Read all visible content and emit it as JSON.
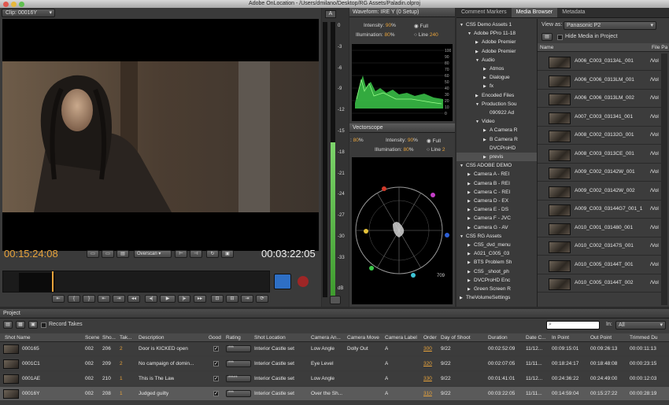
{
  "window": {
    "title": "Adobe OnLocation - /Users/dmilano/Desktop/RG Assets/Paladin.olproj"
  },
  "monitor": {
    "clip_label": "Clip: 00016Y",
    "timecode_current": "00:15:24:08",
    "timecode_duration": "00:03:22:05",
    "overscan": "Overscan"
  },
  "meter": {
    "label": "A",
    "ticks": [
      "0",
      "-3",
      "-6",
      "-9",
      "-12",
      "-15",
      "-18",
      "-21",
      "-24",
      "-27",
      "-30",
      "-33"
    ],
    "db": "dB"
  },
  "waveform": {
    "title": "Waveform: IRE Y (0 Setup)",
    "intensity_label": "Intensity:",
    "intensity_value": "90",
    "illumination_label": "Illumination:",
    "illumination_value": "80",
    "pct": "%",
    "opt_full": "Full",
    "opt_line": "Line",
    "line_value": "240",
    "scale": [
      "100",
      "90",
      "80",
      "70",
      "60",
      "50",
      "40",
      "30",
      "20",
      "10",
      "0"
    ]
  },
  "vectorscope": {
    "title": "Vectorscope",
    "left_value": "80",
    "pct": "%",
    "intensity_label": "Intensity:",
    "intensity_value": "90",
    "illumination_label": "Illumination:",
    "illumination_value": "80",
    "opt_full": "Full",
    "opt_line": "Line",
    "line_value": "2",
    "readout": "709"
  },
  "tabs": {
    "comment_markers": "Comment Markers",
    "media_browser": "Media Browser",
    "metadata": "Metadata"
  },
  "tree": [
    {
      "indent": 0,
      "arrow": "▼",
      "label": "CS5 Demo Assets 1"
    },
    {
      "indent": 1,
      "arrow": "▼",
      "label": "Adobe PPro 11-18"
    },
    {
      "indent": 2,
      "arrow": "▶",
      "label": "Adobe Premier"
    },
    {
      "indent": 2,
      "arrow": "▶",
      "label": "Adobe Premier"
    },
    {
      "indent": 2,
      "arrow": "▼",
      "label": "Audio"
    },
    {
      "indent": 3,
      "arrow": "▶",
      "label": "Atmos"
    },
    {
      "indent": 3,
      "arrow": "▶",
      "label": "Dialogue"
    },
    {
      "indent": 3,
      "arrow": "▶",
      "label": "fx"
    },
    {
      "indent": 2,
      "arrow": "▶",
      "label": "Encoded Files"
    },
    {
      "indent": 2,
      "arrow": "▼",
      "label": "Production Sou"
    },
    {
      "indent": 3,
      "arrow": "",
      "label": "090922 Ad"
    },
    {
      "indent": 2,
      "arrow": "▼",
      "label": "Video"
    },
    {
      "indent": 3,
      "arrow": "▶",
      "label": "A Camera R"
    },
    {
      "indent": 3,
      "arrow": "▶",
      "label": "B Camera R"
    },
    {
      "indent": 3,
      "arrow": "",
      "label": "DVCProHD"
    },
    {
      "indent": 3,
      "arrow": "▶",
      "label": "previs"
    },
    {
      "indent": 0,
      "arrow": "▼",
      "label": "CS5 ADOBE DEMO"
    },
    {
      "indent": 1,
      "arrow": "▶",
      "label": "Camera A - REI"
    },
    {
      "indent": 1,
      "arrow": "▶",
      "label": "Camera B - REI"
    },
    {
      "indent": 1,
      "arrow": "▶",
      "label": "Camera C - REI"
    },
    {
      "indent": 1,
      "arrow": "▶",
      "label": "Camera D - EX"
    },
    {
      "indent": 1,
      "arrow": "▶",
      "label": "Camera E - DS"
    },
    {
      "indent": 1,
      "arrow": "▶",
      "label": "Camera F - JVC"
    },
    {
      "indent": 1,
      "arrow": "▶",
      "label": "Camera G - AV"
    },
    {
      "indent": 0,
      "arrow": "▼",
      "label": "CS5 RG Assets"
    },
    {
      "indent": 1,
      "arrow": "▶",
      "label": "CS5_dvd_menu"
    },
    {
      "indent": 1,
      "arrow": "▶",
      "label": "A021_C005_03"
    },
    {
      "indent": 1,
      "arrow": "▶",
      "label": "BTS Problem Sh"
    },
    {
      "indent": 1,
      "arrow": "▶",
      "label": "CS5 _shoot_ph"
    },
    {
      "indent": 1,
      "arrow": "▶",
      "label": "DVCProHD Enc"
    },
    {
      "indent": 1,
      "arrow": "▶",
      "label": "Green Screen R"
    },
    {
      "indent": 0,
      "arrow": "▶",
      "label": "TheVolumeSettings"
    }
  ],
  "media_browser": {
    "view_as_label": "View as:",
    "view_as_value": "Panasonic P2",
    "hide_media_label": "Hide Media in Project",
    "col_name": "Name",
    "col_path": "File Pa",
    "items": [
      {
        "name": "A006_C003_0313AL_001",
        "path": "/Vol"
      },
      {
        "name": "A006_C006_0313LM_001",
        "path": "/Vol"
      },
      {
        "name": "A006_C006_0313LM_002",
        "path": "/Vol"
      },
      {
        "name": "A007_C003_031341_001",
        "path": "/Vol"
      },
      {
        "name": "A008_C002_03132G_001",
        "path": "/Vol"
      },
      {
        "name": "A008_C003_0313CE_001",
        "path": "/Vol"
      },
      {
        "name": "A009_C002_03142W_001",
        "path": "/Vol"
      },
      {
        "name": "A009_C002_03142W_002",
        "path": "/Vol"
      },
      {
        "name": "A009_C003_03144G7_001_1",
        "path": "/Vol"
      },
      {
        "name": "A010_C001_031480_001",
        "path": "/Vol"
      },
      {
        "name": "A010_C002_03147S_001",
        "path": "/Vol"
      },
      {
        "name": "A010_C005_03144T_001",
        "path": "/Vol"
      },
      {
        "name": "A010_C005_03144T_002",
        "path": "/Vol"
      }
    ]
  },
  "project": {
    "title": "Project",
    "record_takes": "Record Takes",
    "in_label": "In:",
    "in_value": "All",
    "columns": [
      "Shot Name",
      "Scene",
      "Sho...",
      "Tak...",
      "Description",
      "Good",
      "Rating",
      "Shot Location",
      "Camera An...",
      "Camera Move",
      "Camera Label",
      "Order",
      "Day of Shoot",
      "Duration",
      "Date C...",
      "In Point",
      "Out Point",
      "Trimmed Du"
    ],
    "rows": [
      {
        "shot": "000165",
        "scene": "002",
        "sho": "206",
        "take": "2",
        "desc": "Door is KICKED open",
        "good": "✓",
        "rating": "***",
        "loc": "Interior Castle set",
        "angle": "Low Angle",
        "move": "Dolly Out",
        "label": "A",
        "order": "300",
        "day": "9/22",
        "dur": "00:02:52:09",
        "date": "11/12...",
        "in": "00:09:15:01",
        "out": "00:09:26:13",
        "trim": "00:00:11:13"
      },
      {
        "shot": "0001C1",
        "scene": "002",
        "sho": "209",
        "take": "2",
        "desc": "No campaign of domin...",
        "good": "✓",
        "rating": "***",
        "loc": "Interior Castle set",
        "angle": "Eye Level",
        "move": "",
        "label": "A",
        "order": "320",
        "day": "9/22",
        "dur": "00:02:07:05",
        "date": "11/11...",
        "in": "00:18:24:17",
        "out": "00:18:48:08",
        "trim": "00:00:23:15"
      },
      {
        "shot": "0001AE",
        "scene": "002",
        "sho": "210",
        "take": "1",
        "desc": "This is The Law",
        "good": "✓",
        "rating": "*****",
        "loc": "Interior Castle set",
        "angle": "Low Angle",
        "move": "",
        "label": "A",
        "order": "330",
        "day": "9/22",
        "dur": "00:01:41:01",
        "date": "11/12...",
        "in": "00:24:36:22",
        "out": "00:24:49:00",
        "trim": "00:00:12:03"
      },
      {
        "shot": "00016Y",
        "scene": "002",
        "sho": "208",
        "take": "1",
        "desc": "Judged guilty",
        "good": "✓",
        "rating": "***",
        "loc": "Interior Castle set",
        "angle": "Over the Sh...",
        "move": "",
        "label": "A",
        "order": "310",
        "day": "9/22",
        "dur": "00:03:22:05",
        "date": "11/11...",
        "in": "00:14:59:04",
        "out": "00:15:27:22",
        "trim": "00:00:28:19"
      }
    ]
  }
}
